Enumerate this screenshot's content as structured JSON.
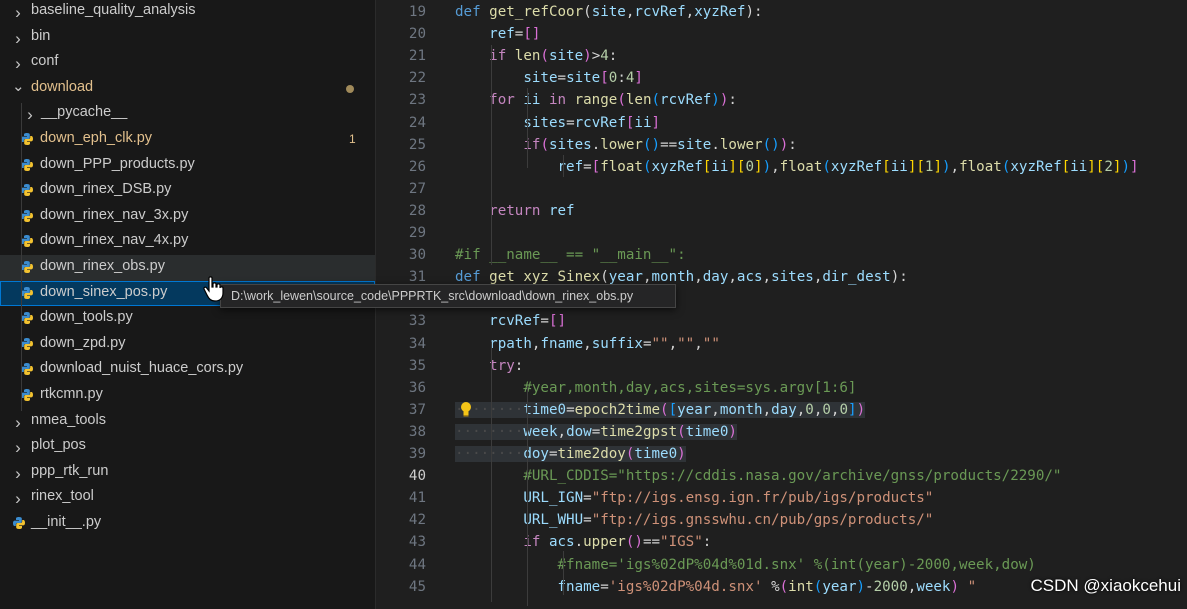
{
  "explorer": {
    "items": [
      {
        "type": "folder",
        "label": "baseline_quality_analysis",
        "open": false
      },
      {
        "type": "folder",
        "label": "bin",
        "open": false
      },
      {
        "type": "folder",
        "label": "conf",
        "open": false
      },
      {
        "type": "folder",
        "label": "download",
        "open": true,
        "modified": true
      },
      {
        "type": "folder",
        "label": "__pycache__",
        "open": false,
        "depth": 1
      },
      {
        "type": "file",
        "label": "down_eph_clk.py",
        "depth": 1,
        "modified": true,
        "badge": "1"
      },
      {
        "type": "file",
        "label": "down_PPP_products.py",
        "depth": 1
      },
      {
        "type": "file",
        "label": "down_rinex_DSB.py",
        "depth": 1
      },
      {
        "type": "file",
        "label": "down_rinex_nav_3x.py",
        "depth": 1
      },
      {
        "type": "file",
        "label": "down_rinex_nav_4x.py",
        "depth": 1
      },
      {
        "type": "file",
        "label": "down_rinex_obs.py",
        "depth": 1,
        "hover": true
      },
      {
        "type": "file",
        "label": "down_sinex_pos.py",
        "depth": 1,
        "selected": true
      },
      {
        "type": "file",
        "label": "down_tools.py",
        "depth": 1
      },
      {
        "type": "file",
        "label": "down_zpd.py",
        "depth": 1
      },
      {
        "type": "file",
        "label": "download_nuist_huace_cors.py",
        "depth": 1
      },
      {
        "type": "file",
        "label": "rtkcmn.py",
        "depth": 1
      },
      {
        "type": "folder",
        "label": "nmea_tools",
        "open": false
      },
      {
        "type": "folder",
        "label": "plot_pos",
        "open": false
      },
      {
        "type": "folder",
        "label": "ppp_rtk_run",
        "open": false
      },
      {
        "type": "folder",
        "label": "rinex_tool",
        "open": false
      },
      {
        "type": "file",
        "label": "__init__.py"
      }
    ]
  },
  "tooltip": {
    "path": "D:\\work_lewen\\source_code\\PPPRTK_src\\download\\down_rinex_obs.py"
  },
  "editor": {
    "current_line": "40",
    "lines": [
      {
        "n": "19",
        "t": [
          [
            "k",
            "def "
          ],
          [
            "f",
            "get_refCoor"
          ],
          [
            "p",
            "("
          ],
          [
            "v",
            "site"
          ],
          [
            "p",
            ","
          ],
          [
            "v",
            "rcvRef"
          ],
          [
            "p",
            ","
          ],
          [
            "v",
            "xyzRef"
          ],
          [
            "p",
            "):"
          ]
        ]
      },
      {
        "n": "20",
        "t": [
          [
            "p",
            "    "
          ],
          [
            "v",
            "ref"
          ],
          [
            "p",
            "="
          ],
          [
            "b2",
            "[]"
          ]
        ]
      },
      {
        "n": "21",
        "t": [
          [
            "p",
            "    "
          ],
          [
            "c",
            "if "
          ],
          [
            "f",
            "len"
          ],
          [
            "b2",
            "("
          ],
          [
            "v",
            "site"
          ],
          [
            "b2",
            ")"
          ],
          [
            "p",
            ">"
          ],
          [
            "n",
            "4"
          ],
          [
            "p",
            ":"
          ]
        ]
      },
      {
        "n": "22",
        "t": [
          [
            "p",
            "        "
          ],
          [
            "v",
            "site"
          ],
          [
            "p",
            "="
          ],
          [
            "v",
            "site"
          ],
          [
            "b2",
            "["
          ],
          [
            "n",
            "0"
          ],
          [
            "p",
            ":"
          ],
          [
            "n",
            "4"
          ],
          [
            "b2",
            "]"
          ]
        ]
      },
      {
        "n": "23",
        "t": [
          [
            "p",
            "    "
          ],
          [
            "c",
            "for "
          ],
          [
            "v",
            "ii "
          ],
          [
            "c",
            "in "
          ],
          [
            "f",
            "range"
          ],
          [
            "b2",
            "("
          ],
          [
            "f",
            "len"
          ],
          [
            "b3",
            "("
          ],
          [
            "v",
            "rcvRef"
          ],
          [
            "b3",
            ")"
          ],
          [
            "b2",
            ")"
          ],
          [
            "p",
            ":"
          ]
        ]
      },
      {
        "n": "24",
        "t": [
          [
            "p",
            "        "
          ],
          [
            "v",
            "sites"
          ],
          [
            "p",
            "="
          ],
          [
            "v",
            "rcvRef"
          ],
          [
            "b2",
            "["
          ],
          [
            "v",
            "ii"
          ],
          [
            "b2",
            "]"
          ]
        ]
      },
      {
        "n": "25",
        "t": [
          [
            "p",
            "        "
          ],
          [
            "c",
            "if"
          ],
          [
            "b2",
            "("
          ],
          [
            "v",
            "sites"
          ],
          [
            "p",
            "."
          ],
          [
            "f",
            "lower"
          ],
          [
            "b3",
            "()"
          ],
          [
            "p",
            "=="
          ],
          [
            "v",
            "site"
          ],
          [
            "p",
            "."
          ],
          [
            "f",
            "lower"
          ],
          [
            "b3",
            "()"
          ],
          [
            "b2",
            ")"
          ],
          [
            "p",
            ":"
          ]
        ]
      },
      {
        "n": "26",
        "t": [
          [
            "p",
            "            "
          ],
          [
            "v",
            "ref"
          ],
          [
            "p",
            "="
          ],
          [
            "b2",
            "["
          ],
          [
            "f",
            "float"
          ],
          [
            "b3",
            "("
          ],
          [
            "v",
            "xyzRef"
          ],
          [
            "b1",
            "["
          ],
          [
            "v",
            "ii"
          ],
          [
            "b1",
            "]"
          ],
          [
            "b1",
            "["
          ],
          [
            "n",
            "0"
          ],
          [
            "b1",
            "]"
          ],
          [
            "b3",
            ")"
          ],
          [
            "p",
            ","
          ],
          [
            "f",
            "float"
          ],
          [
            "b3",
            "("
          ],
          [
            "v",
            "xyzRef"
          ],
          [
            "b1",
            "["
          ],
          [
            "v",
            "ii"
          ],
          [
            "b1",
            "]"
          ],
          [
            "b1",
            "["
          ],
          [
            "n",
            "1"
          ],
          [
            "b1",
            "]"
          ],
          [
            "b3",
            ")"
          ],
          [
            "p",
            ","
          ],
          [
            "f",
            "float"
          ],
          [
            "b3",
            "("
          ],
          [
            "v",
            "xyzRef"
          ],
          [
            "b1",
            "["
          ],
          [
            "v",
            "ii"
          ],
          [
            "b1",
            "]"
          ],
          [
            "b1",
            "["
          ],
          [
            "n",
            "2"
          ],
          [
            "b1",
            "]"
          ],
          [
            "b3",
            ")"
          ],
          [
            "b2",
            "]"
          ]
        ]
      },
      {
        "n": "27",
        "t": []
      },
      {
        "n": "28",
        "t": [
          [
            "p",
            "    "
          ],
          [
            "c",
            "return "
          ],
          [
            "v",
            "ref"
          ]
        ]
      },
      {
        "n": "29",
        "t": []
      },
      {
        "n": "30",
        "t": [
          [
            "cm",
            "#if __name__ == \"__main__\":"
          ]
        ]
      },
      {
        "n": "31",
        "t": [
          [
            "k",
            "def "
          ],
          [
            "f",
            "get_xyz_Sinex"
          ],
          [
            "p",
            "("
          ],
          [
            "v",
            "year"
          ],
          [
            "p",
            ","
          ],
          [
            "v",
            "month"
          ],
          [
            "p",
            ","
          ],
          [
            "v",
            "day"
          ],
          [
            "p",
            ","
          ],
          [
            "v",
            "acs"
          ],
          [
            "p",
            ","
          ],
          [
            "v",
            "sites"
          ],
          [
            "p",
            ","
          ],
          [
            "v",
            "dir_dest"
          ],
          [
            "p",
            "):"
          ]
        ]
      },
      {
        "n": "32",
        "t": []
      },
      {
        "n": "33",
        "t": [
          [
            "p",
            "    "
          ],
          [
            "v",
            "rcvRef"
          ],
          [
            "p",
            "="
          ],
          [
            "b2",
            "[]"
          ]
        ]
      },
      {
        "n": "34",
        "t": [
          [
            "p",
            "    "
          ],
          [
            "v",
            "rpath"
          ],
          [
            "p",
            ","
          ],
          [
            "v",
            "fname"
          ],
          [
            "p",
            ","
          ],
          [
            "v",
            "suffix"
          ],
          [
            "p",
            "="
          ],
          [
            "s",
            "\"\""
          ],
          [
            "p",
            ","
          ],
          [
            "s",
            "\"\""
          ],
          [
            "p",
            ","
          ],
          [
            "s",
            "\"\""
          ]
        ]
      },
      {
        "n": "35",
        "t": [
          [
            "p",
            "    "
          ],
          [
            "c",
            "try"
          ],
          [
            "p",
            ":"
          ]
        ]
      },
      {
        "n": "36",
        "t": [
          [
            "p",
            "        "
          ],
          [
            "cm",
            "#year,month,day,acs,sites=sys.argv[1:6]"
          ]
        ]
      },
      {
        "n": "37",
        "hl": true,
        "t": [
          [
            "ws",
            "········"
          ],
          [
            "v",
            "time0"
          ],
          [
            "p",
            "="
          ],
          [
            "f",
            "epoch2time"
          ],
          [
            "b2",
            "("
          ],
          [
            "b3",
            "["
          ],
          [
            "v",
            "year"
          ],
          [
            "p",
            ","
          ],
          [
            "v",
            "month"
          ],
          [
            "p",
            ","
          ],
          [
            "v",
            "day"
          ],
          [
            "p",
            ","
          ],
          [
            "n",
            "0"
          ],
          [
            "p",
            ","
          ],
          [
            "n",
            "0"
          ],
          [
            "p",
            ","
          ],
          [
            "n",
            "0"
          ],
          [
            "b3",
            "]"
          ],
          [
            "b2",
            ")"
          ]
        ]
      },
      {
        "n": "38",
        "hl": true,
        "t": [
          [
            "ws",
            "········"
          ],
          [
            "v",
            "week"
          ],
          [
            "p",
            ","
          ],
          [
            "v",
            "dow"
          ],
          [
            "p",
            "="
          ],
          [
            "f",
            "time2gpst"
          ],
          [
            "b2",
            "("
          ],
          [
            "v",
            "time0"
          ],
          [
            "b2",
            ")"
          ]
        ]
      },
      {
        "n": "39",
        "hl": true,
        "t": [
          [
            "ws",
            "········"
          ],
          [
            "v",
            "doy"
          ],
          [
            "p",
            "="
          ],
          [
            "f",
            "time2doy"
          ],
          [
            "b2",
            "("
          ],
          [
            "v",
            "time0"
          ],
          [
            "b2",
            ")"
          ]
        ]
      },
      {
        "n": "40",
        "t": [
          [
            "p",
            "        "
          ],
          [
            "cm",
            "#URL_CDDIS=\"https://cddis.nasa.gov/archive/gnss/products/2290/\""
          ]
        ]
      },
      {
        "n": "41",
        "t": [
          [
            "p",
            "        "
          ],
          [
            "v",
            "URL_IGN"
          ],
          [
            "p",
            "="
          ],
          [
            "s",
            "\"ftp://igs.ensg.ign.fr/pub/igs/products\""
          ]
        ]
      },
      {
        "n": "42",
        "t": [
          [
            "p",
            "        "
          ],
          [
            "v",
            "URL_WHU"
          ],
          [
            "p",
            "="
          ],
          [
            "s",
            "\"ftp://igs.gnsswhu.cn/pub/gps/products/\""
          ]
        ]
      },
      {
        "n": "43",
        "t": [
          [
            "p",
            "        "
          ],
          [
            "c",
            "if "
          ],
          [
            "v",
            "acs"
          ],
          [
            "p",
            "."
          ],
          [
            "f",
            "upper"
          ],
          [
            "b2",
            "()"
          ],
          [
            "p",
            "=="
          ],
          [
            "s",
            "\"IGS\""
          ],
          [
            "p",
            ":"
          ]
        ]
      },
      {
        "n": "44",
        "t": [
          [
            "p",
            "            "
          ],
          [
            "cm",
            "#fname='igs%02dP%04d%01d.snx' %(int(year)-2000,week,dow)"
          ]
        ]
      },
      {
        "n": "45",
        "t": [
          [
            "p",
            "            "
          ],
          [
            "v",
            "fname"
          ],
          [
            "p",
            "="
          ],
          [
            "s",
            "'igs%02dP%04d.snx' "
          ],
          [
            "p",
            "%"
          ],
          [
            "b2",
            "("
          ],
          [
            "f",
            "int"
          ],
          [
            "b3",
            "("
          ],
          [
            "v",
            "year"
          ],
          [
            "b3",
            ")"
          ],
          [
            "p",
            "-"
          ],
          [
            "n",
            "2000"
          ],
          [
            "p",
            ","
          ],
          [
            "v",
            "week"
          ],
          [
            "b2",
            ")"
          ],
          [
            "p",
            " "
          ],
          [
            "s",
            "\""
          ]
        ]
      }
    ]
  },
  "watermark": "CSDN @xiaokcehui"
}
